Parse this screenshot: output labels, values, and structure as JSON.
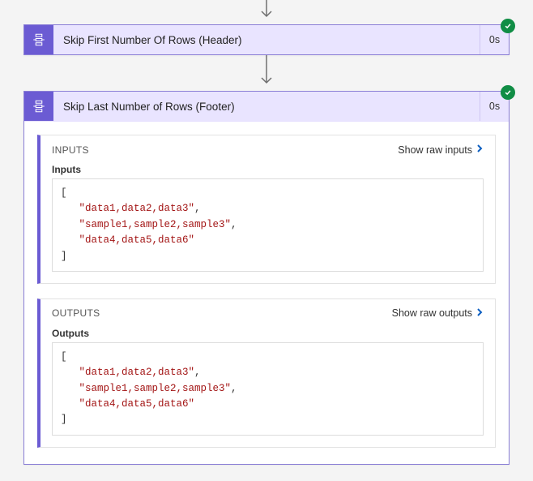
{
  "arrow_top": true,
  "arrow_mid": true,
  "collapsed_step": {
    "icon": "compose-action-icon",
    "title": "Skip First Number Of Rows (Header)",
    "duration": "0s",
    "status": "success"
  },
  "expanded_step": {
    "icon": "compose-action-icon",
    "title": "Skip Last Number of Rows (Footer)",
    "duration": "0s",
    "status": "success",
    "inputs": {
      "heading": "INPUTS",
      "show_raw_label": "Show raw inputs",
      "field_label": "Inputs",
      "value": [
        "data1,data2,data3",
        "sample1,sample2,sample3",
        "data4,data5,data6"
      ]
    },
    "outputs": {
      "heading": "OUTPUTS",
      "show_raw_label": "Show raw outputs",
      "field_label": "Outputs",
      "value": [
        "data1,data2,data3",
        "sample1,sample2,sample3",
        "data4,data5,data6"
      ]
    }
  }
}
